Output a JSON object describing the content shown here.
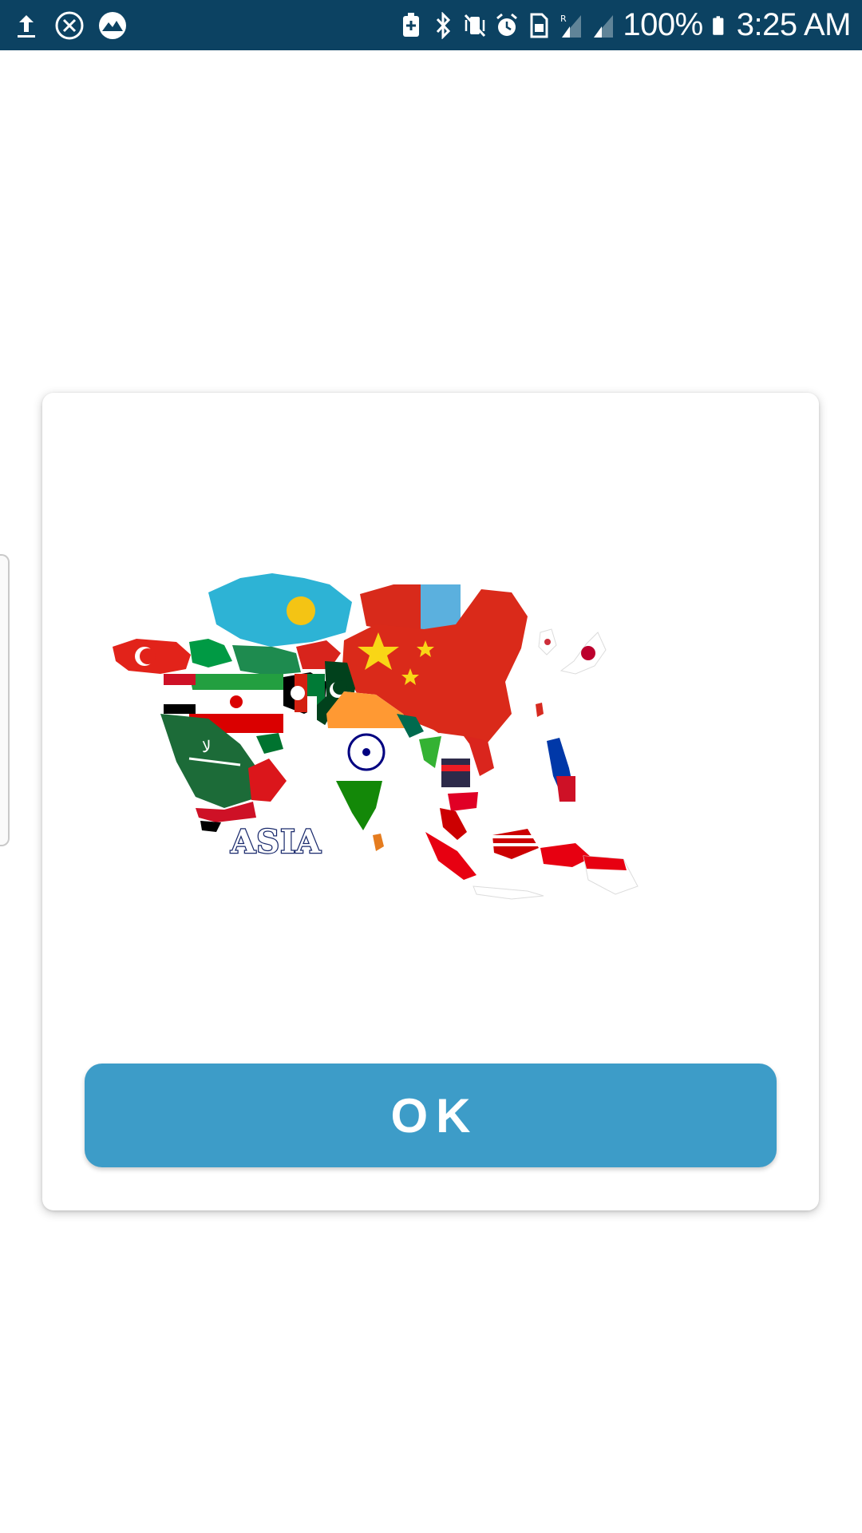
{
  "status_bar": {
    "background": "#0c4262",
    "left_icons": [
      "upload-icon",
      "close-circle-icon",
      "mountain-icon"
    ],
    "right_icons": [
      "battery-saver-icon",
      "bluetooth-icon",
      "vibrate-mute-icon",
      "alarm-icon",
      "sim-card-icon",
      "signal-roaming-icon",
      "signal-icon",
      "battery-icon"
    ],
    "battery_text": "100%",
    "time": "3:25 AM"
  },
  "dialog": {
    "image_description_icon": "asia-flag-map-image",
    "map_label": "ASIA",
    "ok_button_label": "OK",
    "ok_button_color": "#3d9cc8"
  }
}
